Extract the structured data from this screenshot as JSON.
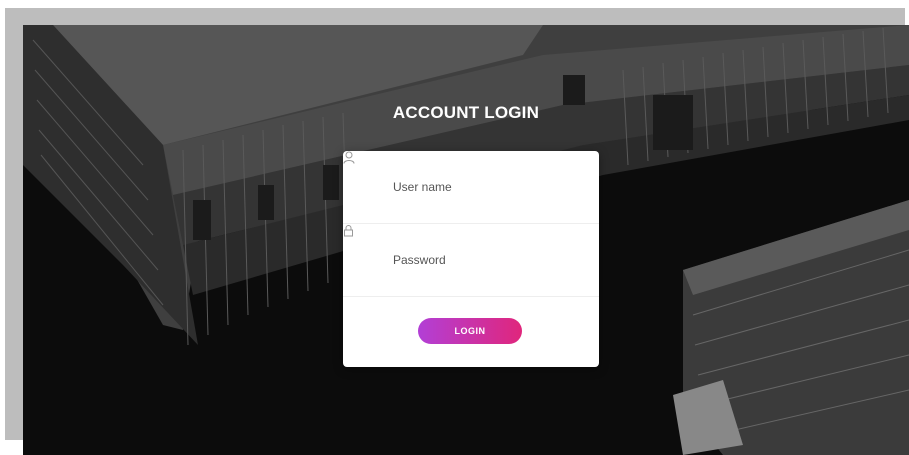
{
  "page": {
    "title": "ACCOUNT LOGIN"
  },
  "login_form": {
    "username_placeholder": "User name",
    "username_icon": "user-icon",
    "password_placeholder": "Password",
    "password_icon": "lock-icon",
    "submit_label": "LOGIN"
  },
  "colors": {
    "background": "#0c0c0c",
    "card": "#ffffff",
    "button_gradient_start": "#b23fd6",
    "button_gradient_end": "#e0267c",
    "title_text": "#ffffff"
  }
}
